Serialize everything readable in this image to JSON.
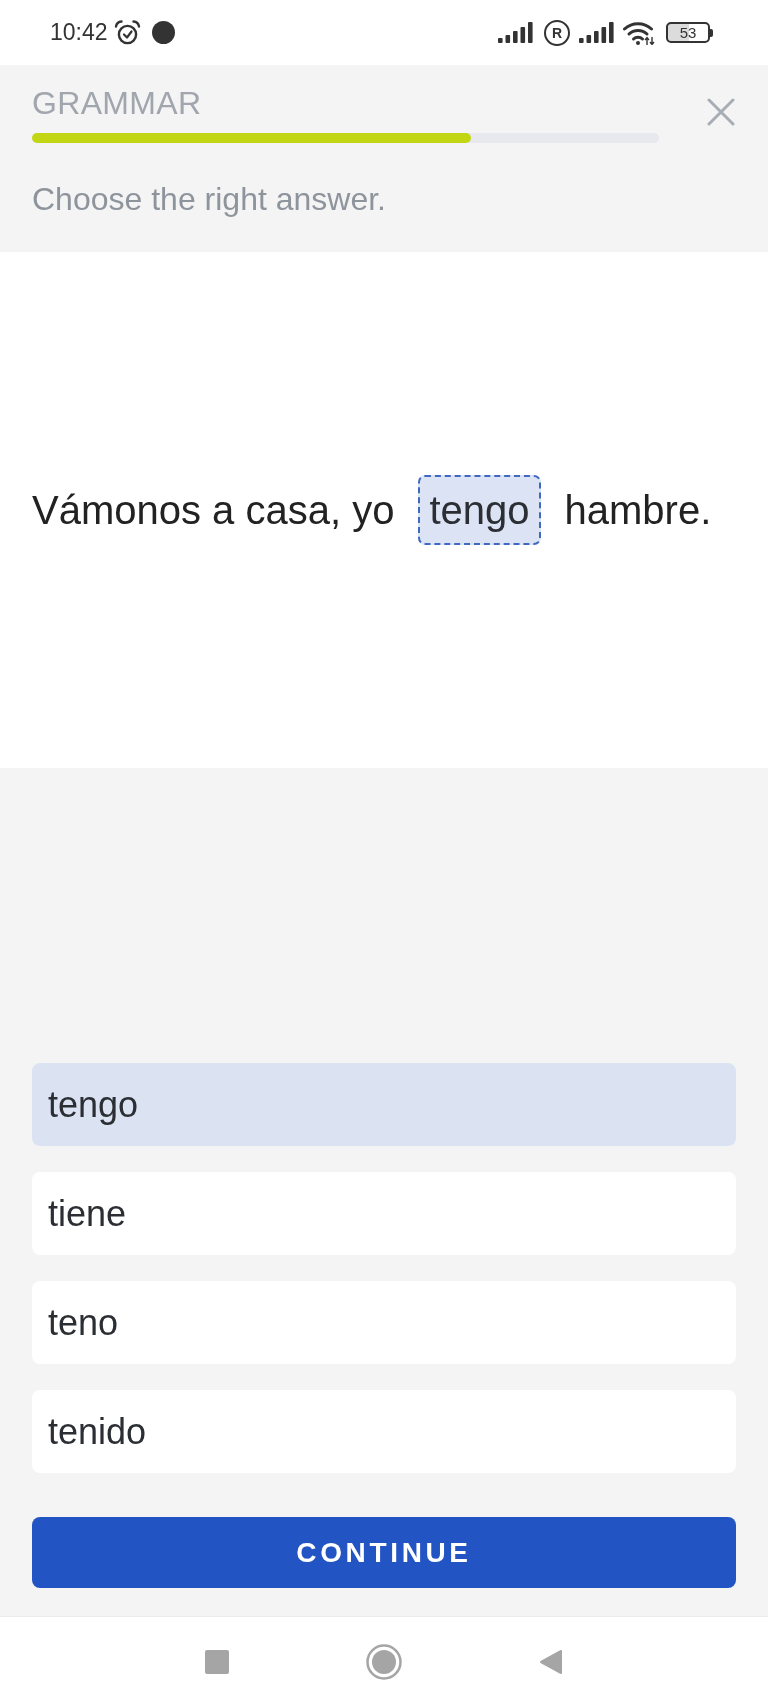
{
  "status_bar": {
    "time": "10:42",
    "roaming": "R",
    "battery": "53"
  },
  "header": {
    "title": "GRAMMAR",
    "progress": {
      "level": 0.7
    },
    "instruction": "Choose the right answer."
  },
  "sentence": {
    "before": "Vámonos a casa, yo",
    "answer": "tengo",
    "after": "hambre."
  },
  "options": [
    {
      "label": "tengo",
      "selected": true
    },
    {
      "label": "tiene",
      "selected": false
    },
    {
      "label": "teno",
      "selected": false
    },
    {
      "label": "tenido",
      "selected": false
    }
  ],
  "continue_button": {
    "label": "CONTINUE"
  }
}
